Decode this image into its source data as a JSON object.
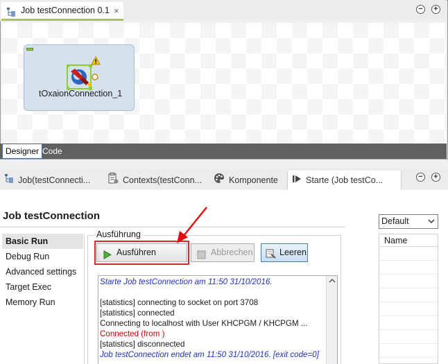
{
  "editor": {
    "tab_title": "Job testConnection 0.1",
    "close_glyph": "×",
    "minimize_glyph": "−",
    "maximize_glyph": "+",
    "component_label": "tOxaionConnection_1",
    "designer_tab": "Designer",
    "code_tab": "Code"
  },
  "panel_tabs": [
    {
      "label": "Job(testConnecti...",
      "icon": "job-icon"
    },
    {
      "label": "Contexts(testConn...",
      "icon": "contexts-icon"
    },
    {
      "label": "Komponente",
      "icon": "palette-icon"
    },
    {
      "label": "Starte (Job testCo...",
      "icon": "run-icon"
    }
  ],
  "run_panel": {
    "title": "Job testConnection",
    "menu": [
      "Basic Run",
      "Debug Run",
      "Advanced settings",
      "Target Exec",
      "Memory Run"
    ],
    "group_label": "Ausführung",
    "run_label": "Ausführen",
    "abort_label": "Abbrechen",
    "clear_label": "Leeren",
    "console": [
      {
        "text": "Starte Job testConnection am 11:50 31/10/2016.",
        "style": "blue"
      },
      {
        "text": "",
        "style": "normal"
      },
      {
        "text": "[statistics] connecting to socket on port 3708",
        "style": "normal"
      },
      {
        "text": "[statistics] connected",
        "style": "normal"
      },
      {
        "text": "Connecting to localhost with User KHCPGM / KHCPGM ...",
        "style": "normal"
      },
      {
        "text": "Connected (from )",
        "style": "red"
      },
      {
        "text": "[statistics] disconnected",
        "style": "normal"
      },
      {
        "text": "Job testConnection endet am 11:50 31/10/2016. [exit code=0]",
        "style": "blue"
      }
    ],
    "context_select": "Default",
    "context_header": "Name"
  },
  "colors": {
    "accent": "#a6c84a",
    "highlight_red": "#d9262a",
    "console_blue": "#2030c8",
    "console_red": "#d00000"
  }
}
